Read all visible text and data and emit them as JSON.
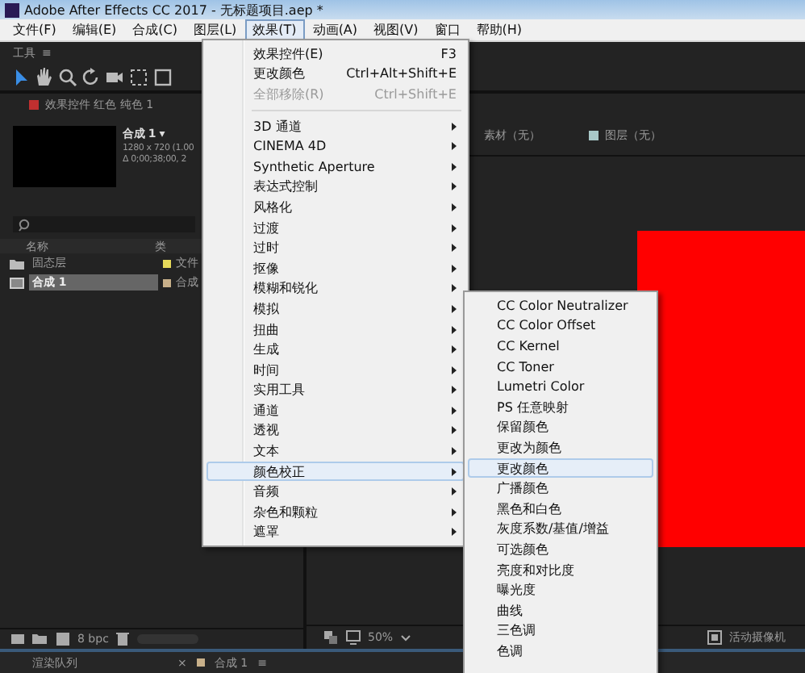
{
  "window": {
    "title": "Adobe After Effects CC 2017 - 无标题项目.aep *"
  },
  "menubar": [
    {
      "label": "文件(F)",
      "selected": false
    },
    {
      "label": "编辑(E)",
      "selected": false
    },
    {
      "label": "合成(C)",
      "selected": false
    },
    {
      "label": "图层(L)",
      "selected": false
    },
    {
      "label": "效果(T)",
      "selected": true
    },
    {
      "label": "动画(A)",
      "selected": false
    },
    {
      "label": "视图(V)",
      "selected": false
    },
    {
      "label": "窗口",
      "selected": false
    },
    {
      "label": "帮助(H)",
      "selected": false
    }
  ],
  "tools_panel": {
    "title": "工具",
    "menu_glyph": "≡"
  },
  "effect_controls_tab": {
    "label": "效果控件 红色 纯色 1"
  },
  "viewer_tabs": [
    {
      "label": "素材（无）"
    },
    {
      "label": "图层（无）"
    }
  ],
  "project": {
    "comp_name": "合成 1 ▾",
    "comp_size": "1280 x 720 (1.00",
    "comp_duration": "Δ 0;00;38;00, 2",
    "columns": [
      "名称",
      "类"
    ],
    "rows": [
      {
        "name": "固态层",
        "type": "文件",
        "kind": "folder",
        "selected": false,
        "color": "#e6d95a"
      },
      {
        "name": "合成 1",
        "type": "合成",
        "kind": "comp",
        "selected": true,
        "color": "#c8b08a"
      }
    ],
    "bit_depth": "8 bpc"
  },
  "viewer": {
    "zoom": "50%",
    "camera": "活动摄像机"
  },
  "bottom_tabs": [
    {
      "label": "渲染队列"
    },
    {
      "label": "合成 1",
      "close": "×",
      "menu": "≡"
    }
  ],
  "effect_menu": [
    {
      "kind": "item",
      "label": "效果控件(E)",
      "shortcut": "F3",
      "disabled": false,
      "submenu": false,
      "selected": false
    },
    {
      "kind": "item",
      "label": "更改颜色",
      "shortcut": "Ctrl+Alt+Shift+E",
      "disabled": false,
      "submenu": false,
      "selected": false
    },
    {
      "kind": "item",
      "label": "全部移除(R)",
      "shortcut": "Ctrl+Shift+E",
      "disabled": true,
      "submenu": false,
      "selected": false
    },
    {
      "kind": "separator"
    },
    {
      "kind": "item",
      "label": "3D 通道",
      "disabled": false,
      "submenu": true,
      "selected": false
    },
    {
      "kind": "item",
      "label": "CINEMA 4D",
      "disabled": false,
      "submenu": true,
      "selected": false
    },
    {
      "kind": "item",
      "label": "Synthetic Aperture",
      "disabled": false,
      "submenu": true,
      "selected": false
    },
    {
      "kind": "item",
      "label": "表达式控制",
      "disabled": false,
      "submenu": true,
      "selected": false
    },
    {
      "kind": "item",
      "label": "风格化",
      "disabled": false,
      "submenu": true,
      "selected": false
    },
    {
      "kind": "item",
      "label": "过渡",
      "disabled": false,
      "submenu": true,
      "selected": false
    },
    {
      "kind": "item",
      "label": "过时",
      "disabled": false,
      "submenu": true,
      "selected": false
    },
    {
      "kind": "item",
      "label": "抠像",
      "disabled": false,
      "submenu": true,
      "selected": false
    },
    {
      "kind": "item",
      "label": "模糊和锐化",
      "disabled": false,
      "submenu": true,
      "selected": false
    },
    {
      "kind": "item",
      "label": "模拟",
      "disabled": false,
      "submenu": true,
      "selected": false
    },
    {
      "kind": "item",
      "label": "扭曲",
      "disabled": false,
      "submenu": true,
      "selected": false
    },
    {
      "kind": "item",
      "label": "生成",
      "disabled": false,
      "submenu": true,
      "selected": false
    },
    {
      "kind": "item",
      "label": "时间",
      "disabled": false,
      "submenu": true,
      "selected": false
    },
    {
      "kind": "item",
      "label": "实用工具",
      "disabled": false,
      "submenu": true,
      "selected": false
    },
    {
      "kind": "item",
      "label": "通道",
      "disabled": false,
      "submenu": true,
      "selected": false
    },
    {
      "kind": "item",
      "label": "透视",
      "disabled": false,
      "submenu": true,
      "selected": false
    },
    {
      "kind": "item",
      "label": "文本",
      "disabled": false,
      "submenu": true,
      "selected": false
    },
    {
      "kind": "item",
      "label": "颜色校正",
      "disabled": false,
      "submenu": true,
      "selected": true
    },
    {
      "kind": "item",
      "label": "音频",
      "disabled": false,
      "submenu": true,
      "selected": false
    },
    {
      "kind": "item",
      "label": "杂色和颗粒",
      "disabled": false,
      "submenu": true,
      "selected": false
    },
    {
      "kind": "item",
      "label": "遮罩",
      "disabled": false,
      "submenu": true,
      "selected": false
    }
  ],
  "color_correction_submenu": [
    {
      "label": "CC Color Neutralizer",
      "selected": false
    },
    {
      "label": "CC Color Offset",
      "selected": false
    },
    {
      "label": "CC Kernel",
      "selected": false
    },
    {
      "label": "CC Toner",
      "selected": false
    },
    {
      "label": "Lumetri Color",
      "selected": false
    },
    {
      "label": "PS 任意映射",
      "selected": false
    },
    {
      "label": "保留颜色",
      "selected": false
    },
    {
      "label": "更改为颜色",
      "selected": false
    },
    {
      "label": "更改颜色",
      "selected": true
    },
    {
      "label": "广播颜色",
      "selected": false
    },
    {
      "label": "黑色和白色",
      "selected": false
    },
    {
      "label": "灰度系数/基值/增益",
      "selected": false
    },
    {
      "label": "可选颜色",
      "selected": false
    },
    {
      "label": "亮度和对比度",
      "selected": false
    },
    {
      "label": "曝光度",
      "selected": false
    },
    {
      "label": "曲线",
      "selected": false
    },
    {
      "label": "三色调",
      "selected": false
    },
    {
      "label": "色调",
      "selected": false
    }
  ]
}
